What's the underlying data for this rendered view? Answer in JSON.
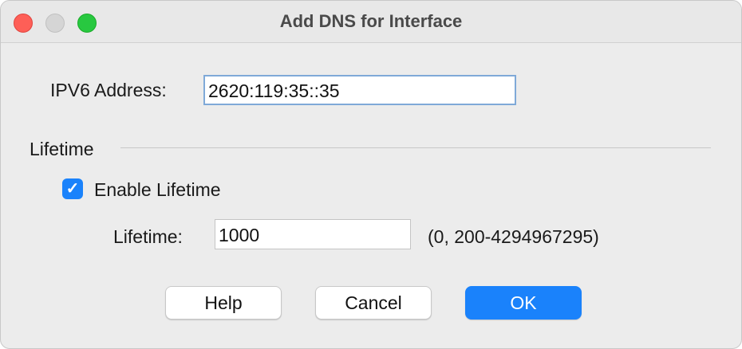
{
  "window": {
    "title": "Add DNS for Interface"
  },
  "ipv6": {
    "label": "IPV6 Address:",
    "value": "2620:119:35::35"
  },
  "lifetime_section": {
    "title": "Lifetime",
    "enable_label": "Enable Lifetime",
    "enable_checked": true,
    "field_label": "Lifetime:",
    "value": "1000",
    "range_hint": "(0, 200-4294967295)"
  },
  "buttons": {
    "help": "Help",
    "cancel": "Cancel",
    "ok": "OK"
  },
  "colors": {
    "accent": "#1a82fb"
  }
}
